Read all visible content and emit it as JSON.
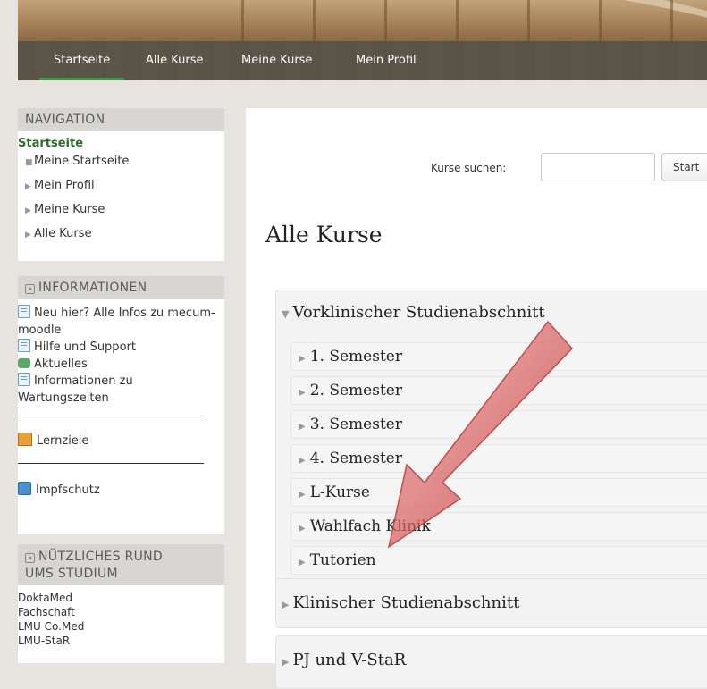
{
  "navbar": {
    "items": [
      "Startseite",
      "Alle Kurse",
      "Meine Kurse",
      "Mein Profil"
    ]
  },
  "navigation": {
    "header": "NAVIGATION",
    "root": "Startseite",
    "items": [
      "Meine Startseite",
      "Mein Profil",
      "Meine Kurse",
      "Alle Kurse"
    ]
  },
  "informationen": {
    "header": "INFORMATIONEN",
    "items": [
      "Neu hier? Alle Infos zu mecum-moodle",
      "Hilfe und Support",
      "Aktuelles",
      "Informationen zu Wartungszeiten"
    ],
    "lernziele": "Lernziele",
    "impfschutz": "Impfschutz"
  },
  "nuetzliches": {
    "header_line1": "NÜTZLICHES RUND",
    "header_line2": "UMS STUDIUM",
    "links": [
      "DoktaMed",
      "Fachschaft",
      "LMU Co.Med",
      "LMU-StaR"
    ]
  },
  "search": {
    "label": "Kurse suchen:",
    "value": "",
    "button": "Start"
  },
  "main": {
    "title": "Alle Kurse",
    "categories": [
      {
        "name": "Vorklinischer Studienabschnitt",
        "expanded": true,
        "subcategories": [
          "1. Semester",
          "2. Semester",
          "3. Semester",
          "4. Semester",
          "L-Kurse",
          "Wahlfach Klinik",
          "Tutorien"
        ]
      },
      {
        "name": "Klinischer Studienabschnitt",
        "expanded": false
      },
      {
        "name": "PJ und V-StaR",
        "expanded": false
      }
    ]
  },
  "colors": {
    "nav_active": "#3a9a4a",
    "sidebar_root": "#2d6a2d",
    "arrow": "#d94a4a"
  }
}
